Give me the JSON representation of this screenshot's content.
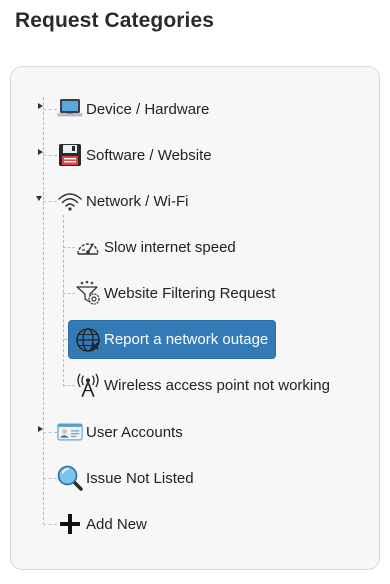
{
  "page": {
    "title": "Request Categories"
  },
  "tree": {
    "device": {
      "label": "Device / Hardware",
      "icon": "laptop-icon",
      "state": "collapsed"
    },
    "software": {
      "label": "Software / Website",
      "icon": "floppy-disk-icon",
      "state": "collapsed"
    },
    "network": {
      "label": "Network / Wi-Fi",
      "icon": "wifi-icon",
      "state": "expanded",
      "children": [
        {
          "label": "Slow internet speed",
          "icon": "speedometer-icon"
        },
        {
          "label": "Website Filtering Request",
          "icon": "filter-gear-icon"
        },
        {
          "label": "Report a network outage",
          "icon": "globe-broken-icon",
          "selected": true
        },
        {
          "label": "Wireless access point not working",
          "icon": "antenna-tower-icon"
        }
      ]
    },
    "accounts": {
      "label": "User Accounts",
      "icon": "id-card-icon",
      "state": "collapsed"
    },
    "not_listed": {
      "label": "Issue Not Listed",
      "icon": "magnifier-icon"
    },
    "add_new": {
      "label": "Add New",
      "icon": "plus-icon"
    }
  },
  "colors": {
    "selected_bg": "#337ab7",
    "panel_bg": "#f7f7f7",
    "panel_border": "#d9d9d9"
  }
}
